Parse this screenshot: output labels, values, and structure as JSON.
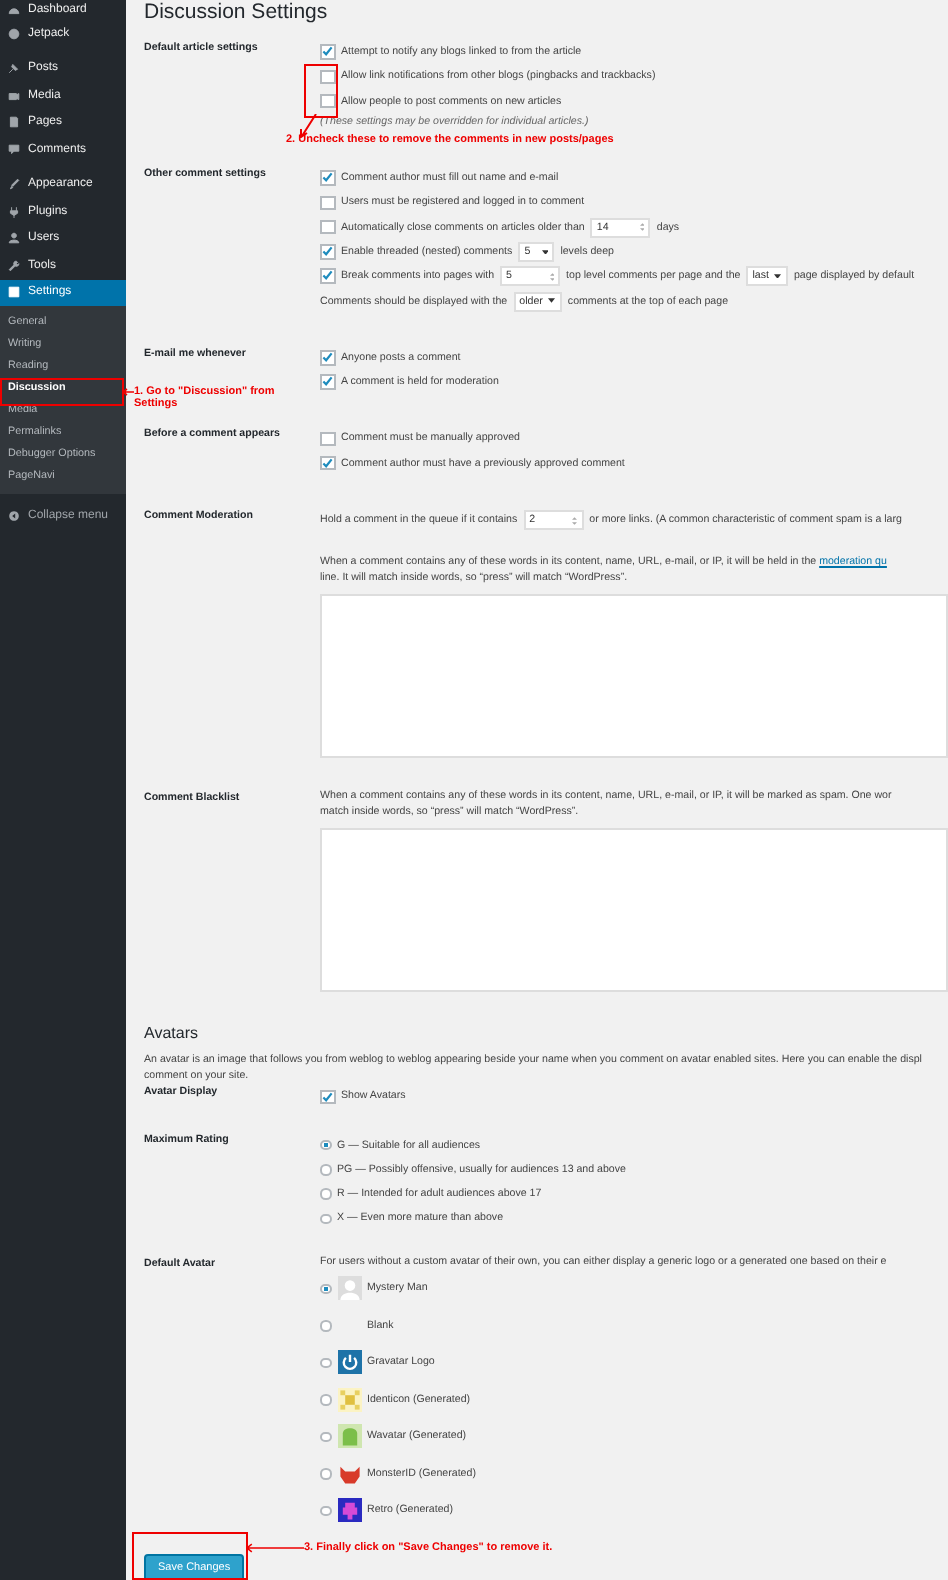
{
  "sidebar": {
    "items": [
      {
        "label": "Dashboard",
        "selected": false
      },
      {
        "label": "Jetpack",
        "selected": false
      },
      {
        "label": "Posts",
        "selected": false
      },
      {
        "label": "Media",
        "selected": false
      },
      {
        "label": "Pages",
        "selected": false
      },
      {
        "label": "Comments",
        "selected": false
      },
      {
        "label": "Appearance",
        "selected": false
      },
      {
        "label": "Plugins",
        "selected": false
      },
      {
        "label": "Users",
        "selected": false
      },
      {
        "label": "Tools",
        "selected": false
      },
      {
        "label": "Settings",
        "selected": true,
        "children": [
          {
            "label": "General",
            "selected": false
          },
          {
            "label": "Writing",
            "selected": false
          },
          {
            "label": "Reading",
            "selected": false
          },
          {
            "label": "Discussion",
            "selected": true
          },
          {
            "label": "Media",
            "selected": false
          },
          {
            "label": "Permalinks",
            "selected": false
          },
          {
            "label": "Debugger Options",
            "selected": false
          },
          {
            "label": "PageNavi",
            "selected": false
          }
        ]
      }
    ],
    "collapse": "Collapse menu"
  },
  "title": "Discussion Settings",
  "sections": [
    {
      "kind": "options",
      "label": "Default article settings",
      "options": [
        {
          "kind": "checkbox",
          "checked": true,
          "parts": [
            {
              "kind": "text",
              "text": "Attempt to notify any blogs linked to from the article"
            }
          ]
        },
        {
          "kind": "checkbox",
          "checked": false,
          "parts": [
            {
              "kind": "text",
              "text": "Allow link notifications from other blogs (pingbacks and trackbacks)"
            }
          ]
        },
        {
          "kind": "checkbox",
          "checked": false,
          "parts": [
            {
              "kind": "text",
              "text": "Allow people to post comments on new articles"
            }
          ]
        }
      ],
      "note": "(These settings may be overridden for individual articles.)"
    },
    {
      "kind": "options",
      "label": "Other comment settings",
      "options": [
        {
          "kind": "checkbox",
          "checked": true,
          "parts": [
            {
              "kind": "text",
              "text": "Comment author must fill out name and e-mail"
            }
          ]
        },
        {
          "kind": "checkbox",
          "checked": false,
          "parts": [
            {
              "kind": "text",
              "text": "Users must be registered and logged in to comment"
            }
          ]
        },
        {
          "kind": "checkbox",
          "checked": false,
          "parts": [
            {
              "kind": "text",
              "text": "Automatically close comments on articles older than"
            },
            {
              "kind": "number",
              "value": "14"
            },
            {
              "kind": "text",
              "text": "days"
            }
          ]
        },
        {
          "kind": "checkbox",
          "checked": true,
          "parts": [
            {
              "kind": "text",
              "text": "Enable threaded (nested) comments"
            },
            {
              "kind": "select",
              "value": "5"
            },
            {
              "kind": "text",
              "text": "levels deep"
            }
          ]
        },
        {
          "kind": "checkbox",
          "checked": true,
          "parts": [
            {
              "kind": "text",
              "text": "Break comments into pages with"
            },
            {
              "kind": "number",
              "value": "5"
            },
            {
              "kind": "text",
              "text": "top level comments per page and the"
            },
            {
              "kind": "select",
              "value": "last"
            },
            {
              "kind": "text",
              "text": "page displayed by default"
            }
          ]
        },
        {
          "kind": "line",
          "parts": [
            {
              "kind": "text",
              "text": "Comments should be displayed with the"
            },
            {
              "kind": "select",
              "value": "older"
            },
            {
              "kind": "text",
              "text": "comments at the top of each page"
            }
          ]
        }
      ]
    },
    {
      "kind": "options",
      "label": "E-mail me whenever",
      "options": [
        {
          "kind": "checkbox",
          "checked": true,
          "parts": [
            {
              "kind": "text",
              "text": "Anyone posts a comment"
            }
          ]
        },
        {
          "kind": "checkbox",
          "checked": true,
          "parts": [
            {
              "kind": "text",
              "text": "A comment is held for moderation"
            }
          ]
        }
      ]
    },
    {
      "kind": "options",
      "label": "Before a comment appears",
      "options": [
        {
          "kind": "checkbox",
          "checked": false,
          "parts": [
            {
              "kind": "text",
              "text": "Comment must be manually approved"
            }
          ]
        },
        {
          "kind": "checkbox",
          "checked": true,
          "parts": [
            {
              "kind": "text",
              "text": "Comment author must have a previously approved comment"
            }
          ]
        }
      ]
    },
    {
      "kind": "textarea",
      "label": "Comment Moderation",
      "options": [
        {
          "kind": "line",
          "parts": [
            {
              "kind": "text",
              "text": "Hold a comment in the queue if it contains"
            },
            {
              "kind": "number",
              "value": "2"
            },
            {
              "kind": "text",
              "text": "or more links. (A common characteristic of comment spam is a larg"
            }
          ]
        }
      ],
      "description": [
        {
          "text": "When a comment contains any of these words in its content, name, URL, e-mail, or IP, it will be held in the ",
          "link": "moderation qu"
        },
        {
          "text": "line. It will match inside words, so “press” will match “WordPress”."
        }
      ]
    },
    {
      "kind": "textarea",
      "label": "Comment Blacklist",
      "description": [
        {
          "text": "When a comment contains any of these words in its content, name, URL, e-mail, or IP, it will be marked as spam. One wor"
        },
        {
          "text": "match inside words, so “press” will match “WordPress”."
        }
      ]
    }
  ],
  "avatars": {
    "heading": "Avatars",
    "description": [
      "An avatar is an image that follows you from weblog to weblog appearing beside your name when you comment on avatar enabled sites. Here you can enable the displ",
      "comment on your site."
    ],
    "sections": [
      {
        "kind": "options",
        "label": "Avatar Display",
        "options": [
          {
            "kind": "checkbox",
            "checked": true,
            "parts": [
              {
                "kind": "text",
                "text": "Show Avatars"
              }
            ]
          }
        ]
      },
      {
        "kind": "radios",
        "label": "Maximum Rating",
        "options": [
          {
            "label": "G — Suitable for all audiences",
            "selected": true
          },
          {
            "label": "PG — Possibly offensive, usually for audiences 13 and above",
            "selected": false
          },
          {
            "label": "R — Intended for adult audiences above 17",
            "selected": false
          },
          {
            "label": "X — Even more mature than above",
            "selected": false
          }
        ]
      },
      {
        "kind": "avatars",
        "label": "Default Avatar",
        "intro": "For users without a custom avatar of their own, you can either display a generic logo or a generated one based on their e",
        "options": [
          {
            "label": "Mystery Man",
            "selected": true
          },
          {
            "label": "Blank",
            "selected": false
          },
          {
            "label": "Gravatar Logo",
            "selected": false
          },
          {
            "label": "Identicon (Generated)",
            "selected": false
          },
          {
            "label": "Wavatar (Generated)",
            "selected": false
          },
          {
            "label": "MonsterID (Generated)",
            "selected": false
          },
          {
            "label": "Retro (Generated)",
            "selected": false
          }
        ]
      }
    ]
  },
  "save_button": "Save Changes",
  "annotations": [
    "1. Go to \"Discussion\" from Settings",
    "2. Uncheck these to remove the comments in new posts/pages",
    "3. Finally click on \"Save Changes\" to remove it."
  ]
}
